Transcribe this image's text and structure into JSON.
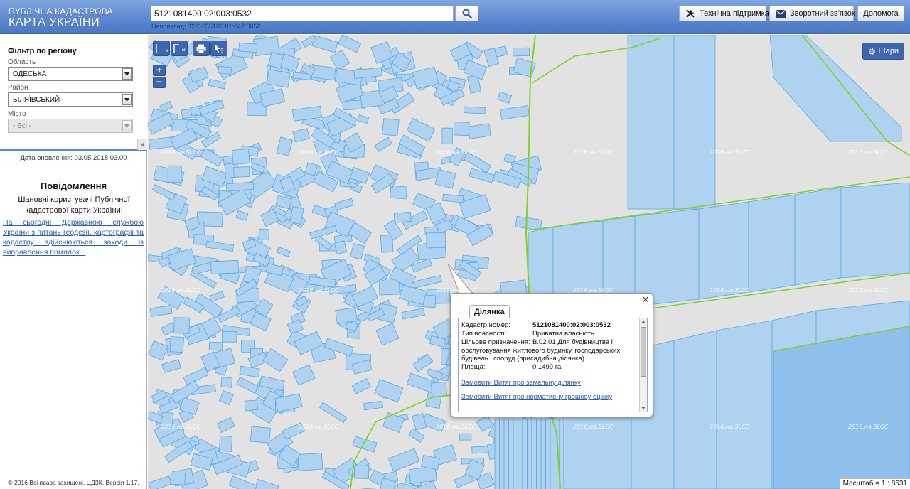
{
  "header": {
    "logo_line1": "ПУБЛІЧНА КАДАСТРОВА",
    "logo_line2": "КАРТА УКРАЇНИ",
    "search_value": "5121081400:02:003:0532",
    "search_hint": "Наприклад: 3221655100:01:047:0052",
    "buttons": {
      "support": "Технічна підтримка",
      "feedback": "Зворотний зв'язок",
      "help": "Допомога"
    }
  },
  "sidebar": {
    "filter_title": "Фільтр по регіону",
    "region_label": "Область",
    "region_value": "ОДЕСЬКА",
    "district_label": "Район",
    "district_value": "БІЛЯЇВСЬКИЙ",
    "city_label": "Місто",
    "city_value": "- Всі -",
    "update_date": "Дата оновлення: 03.05.2018 03.00",
    "messages_title": "Повідомлення",
    "messages_text": "Шановні користувачі Публічної кадастрової карти України!",
    "messages_link": "На сьогодні Державною службою України з питань геодезії, картографії та кадастру здійснюються заходи із виправлення помилок...",
    "copyright": "© 2016 Всі права захищені. ЦДЗК. Версія 1.17."
  },
  "map": {
    "layers_label": "Шари",
    "scale_label": "Масштаб = 1 : 8531",
    "watermark": "2016.на.SLCC",
    "tools": {
      "measure_line": "м",
      "measure_area": "м²",
      "zoom_in": "+",
      "zoom_out": "−"
    },
    "colors": {
      "parcel_fill": "#aed2f0",
      "parcel_stroke": "#5aa8e0",
      "boundary": "#7ed321",
      "background": "#e2e2e2"
    }
  },
  "popup": {
    "tab": "Ділянка",
    "fields": {
      "cad_label": "Кадастр.номер:",
      "cad_value": "5121081400:02:003:0532",
      "own_label": "Тип власності:",
      "own_value": "Приватна власність",
      "purpose_label": "Цільове призначення:",
      "purpose_value": "В.02.01 Для будівництва і обслуговування житлового будинку, господарських будівель і споруд (присадибна ділянка)",
      "area_label": "Площа:",
      "area_value": "0.1499 га"
    },
    "link1": "Замовити Витяг про земельну ділянку",
    "link2": "Замовити Витяг про нормативну грошову оцінку"
  }
}
